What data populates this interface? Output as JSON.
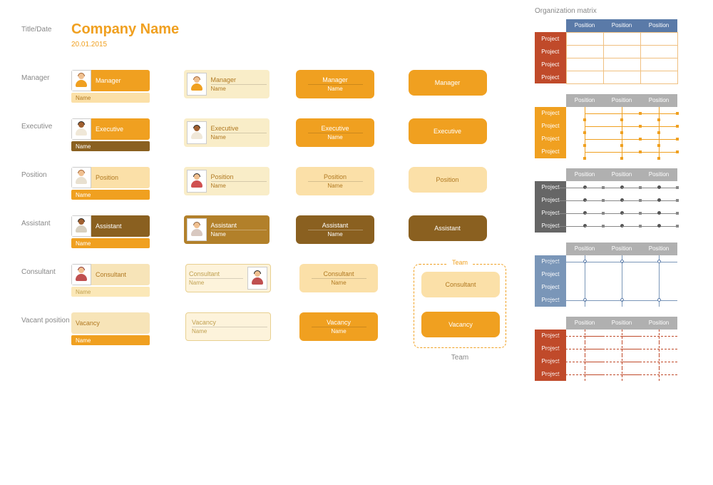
{
  "title_row_label": "Title/Date",
  "company_name": "Company Name",
  "company_date": "20.01.2015",
  "rows": {
    "manager": {
      "label": "Manager",
      "role": "Manager",
      "name": "Name"
    },
    "executive": {
      "label": "Executive",
      "role": "Executive",
      "name": "Name"
    },
    "position": {
      "label": "Position",
      "role": "Position",
      "name": "Name"
    },
    "assistant": {
      "label": "Assistant",
      "role": "Assistant",
      "name": "Name"
    },
    "consultant": {
      "label": "Consultant",
      "role": "Consultant",
      "name": "Name"
    },
    "vacancy": {
      "label": "Vacant position",
      "role": "Vacancy",
      "name": "Name"
    }
  },
  "team_label": "Team",
  "matrix_title": "Organization matrix",
  "matrix_position": "Position",
  "matrix_project": "Project"
}
